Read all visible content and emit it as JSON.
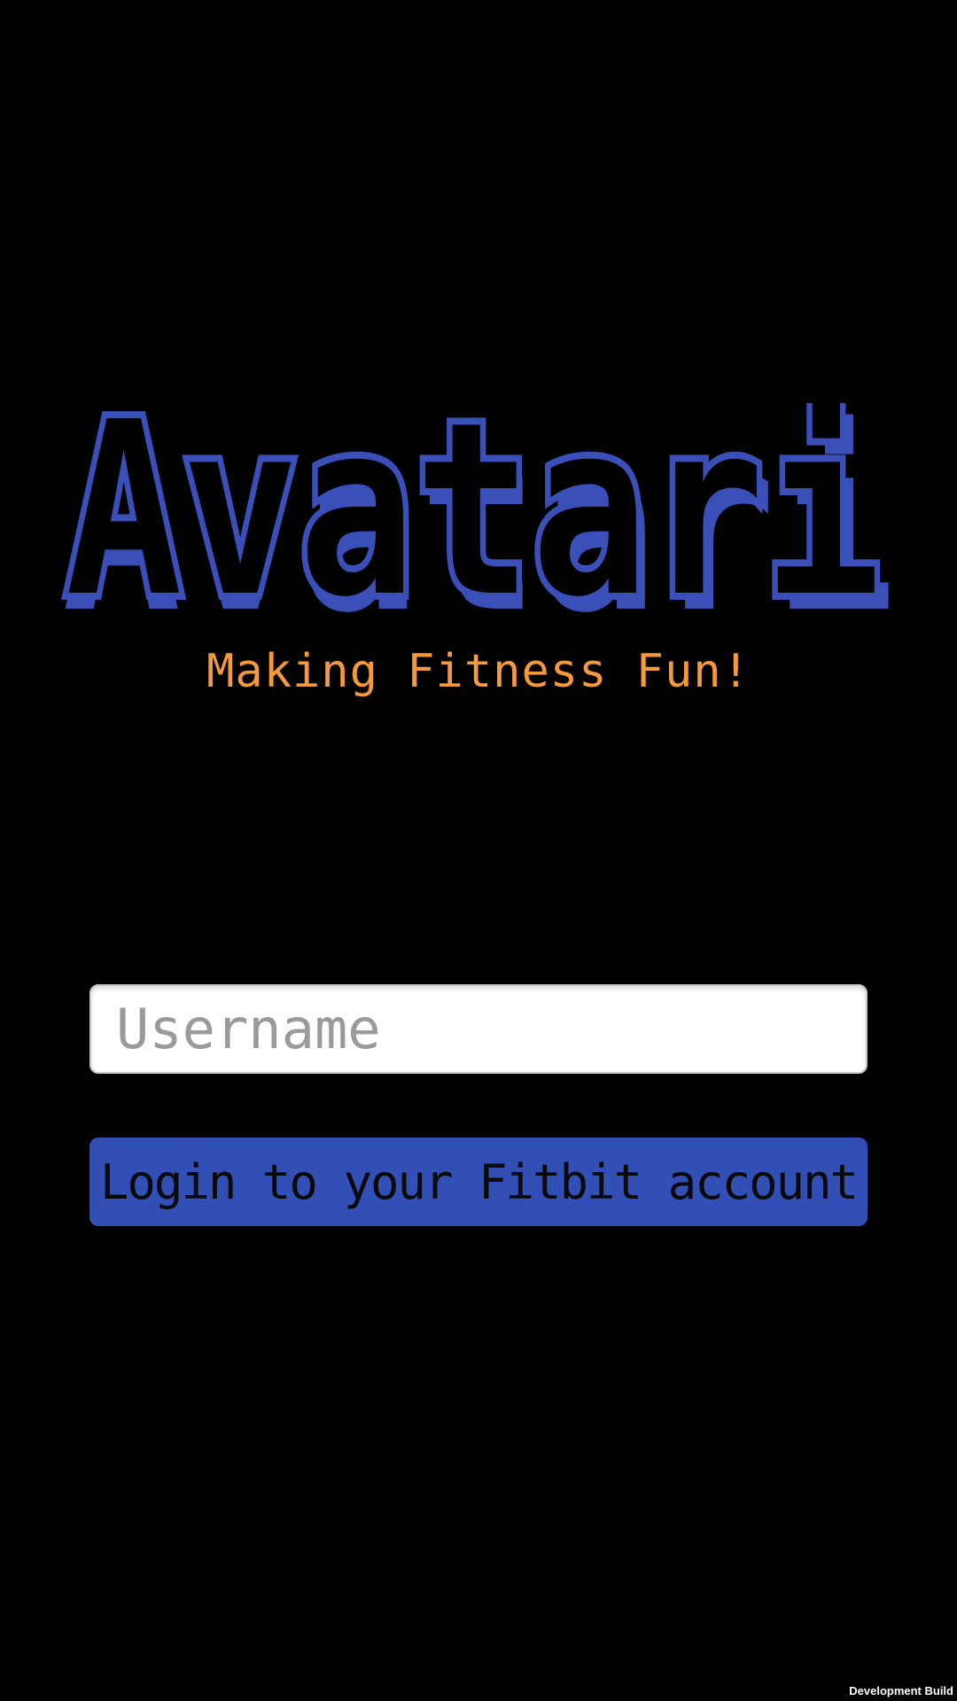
{
  "app": {
    "logo_text": "Avatari",
    "tagline": "Making Fitness Fun!"
  },
  "login": {
    "username_placeholder": "Username",
    "username_value": "",
    "button_label": "Login to your Fitbit account"
  },
  "footer": {
    "build_label": "Development Build"
  },
  "colors": {
    "background": "#000000",
    "logo_blue": "#3a50b8",
    "tagline_orange": "#f4993c",
    "button_blue": "#324fb6"
  }
}
